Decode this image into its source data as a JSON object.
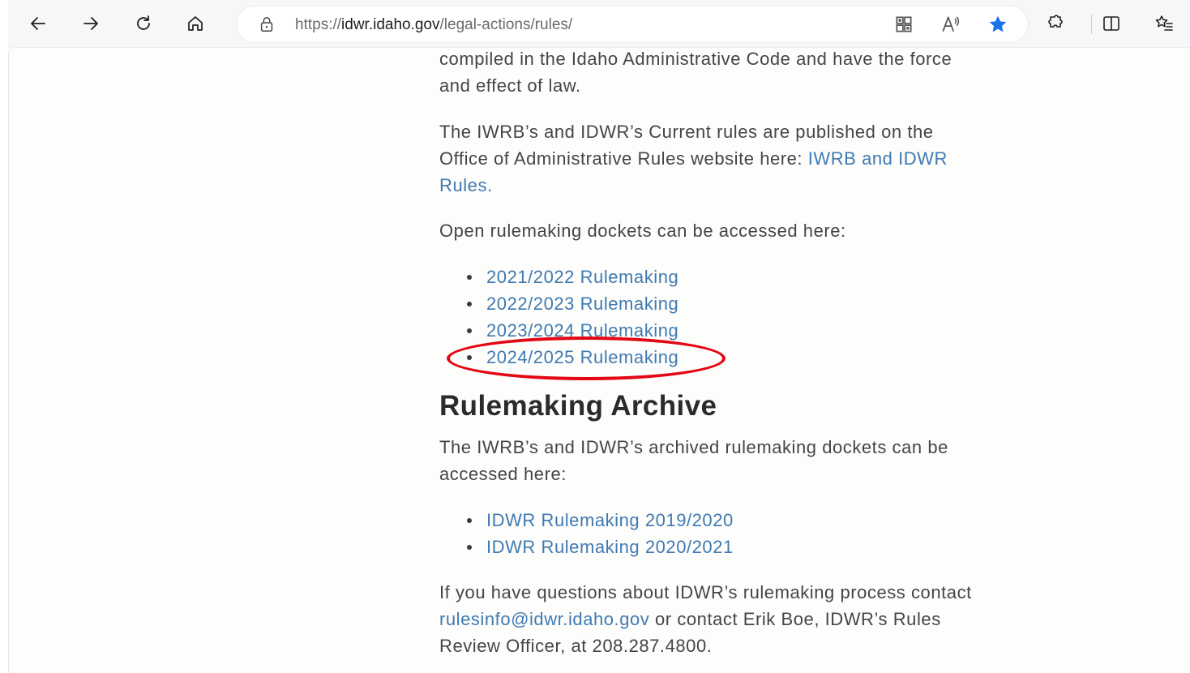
{
  "browser": {
    "url_prefix": "https://",
    "url_host": "idwr.idaho.gov",
    "url_path": "/legal-actions/rules/",
    "favorite_color": "#1a73e8"
  },
  "content": {
    "intro_text": "compiled in the Idaho Administrative Code and have the force and effect of law.",
    "current_rules_text": "The IWRB’s and IDWR’s Current rules are published on the Office of Administrative Rules website here: ",
    "current_rules_link": "IWRB and IDWR Rules.",
    "open_dockets_text": "Open rulemaking dockets can be accessed here:",
    "open_dockets": [
      "2021/2022 Rulemaking",
      "2022/2023 Rulemaking",
      "2023/2024 Rulemaking",
      "2024/2025 Rulemaking"
    ],
    "archive_heading": "Rulemaking Archive",
    "archive_text": "The IWRB’s and IDWR’s archived rulemaking dockets can be accessed here:",
    "archive_links": [
      "IDWR Rulemaking 2019/2020",
      "IDWR Rulemaking 2020/2021"
    ],
    "contact_text_1": "If you have questions about IDWR’s rulemaking process contact ",
    "contact_email": "rulesinfo@idwr.idaho.gov",
    "contact_text_2": " or contact Erik Boe, IDWR’s Rules Review Officer, at 208.287.4800."
  },
  "annotation": {
    "highlight_color": "#e30613"
  }
}
